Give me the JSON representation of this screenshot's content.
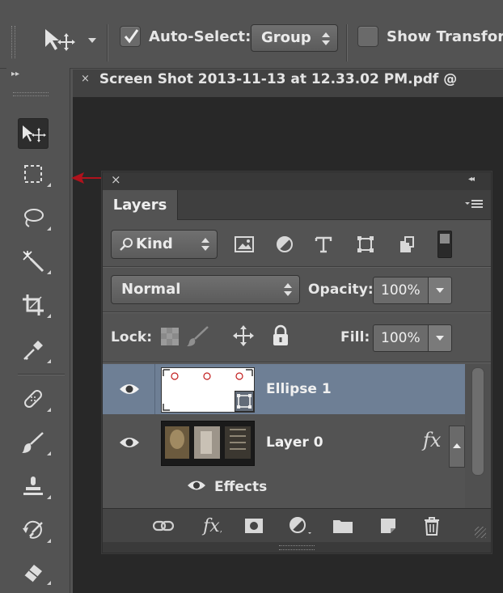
{
  "options_bar": {
    "auto_select_label": "Auto-Select:",
    "auto_select_checked": true,
    "auto_select_mode": "Group",
    "show_transform_label": "Show Transform",
    "show_transform_checked": false
  },
  "document_tab": {
    "close_glyph": "×",
    "title": "Screen Shot 2013-11-13 at 12.33.02 PM.pdf @"
  },
  "tools": [
    {
      "name": "move-tool-icon",
      "active": true
    },
    {
      "name": "rectangular-marquee-tool-icon"
    },
    {
      "name": "lasso-tool-icon"
    },
    {
      "name": "magic-wand-tool-icon"
    },
    {
      "name": "crop-tool-icon"
    },
    {
      "name": "eyedropper-tool-icon"
    },
    {
      "name": "spot-healing-tool-icon"
    },
    {
      "name": "brush-tool-icon"
    },
    {
      "name": "clone-stamp-tool-icon"
    },
    {
      "name": "history-brush-tool-icon"
    },
    {
      "name": "eraser-tool-icon"
    }
  ],
  "layers_panel": {
    "tab_label": "Layers",
    "filter_kind_label": "Kind",
    "blend_mode": "Normal",
    "opacity_label": "Opacity:",
    "opacity_value": "100%",
    "lock_label": "Lock:",
    "fill_label": "Fill:",
    "fill_value": "100%",
    "layers": [
      {
        "name": "Ellipse 1",
        "selected": true,
        "visible": true
      },
      {
        "name": "Layer 0",
        "selected": false,
        "visible": true,
        "fx_label": "fx"
      }
    ],
    "effects_label": "Effects",
    "selection_color": "#6e7f95",
    "annotation_arrow_color": "#b0121c"
  }
}
